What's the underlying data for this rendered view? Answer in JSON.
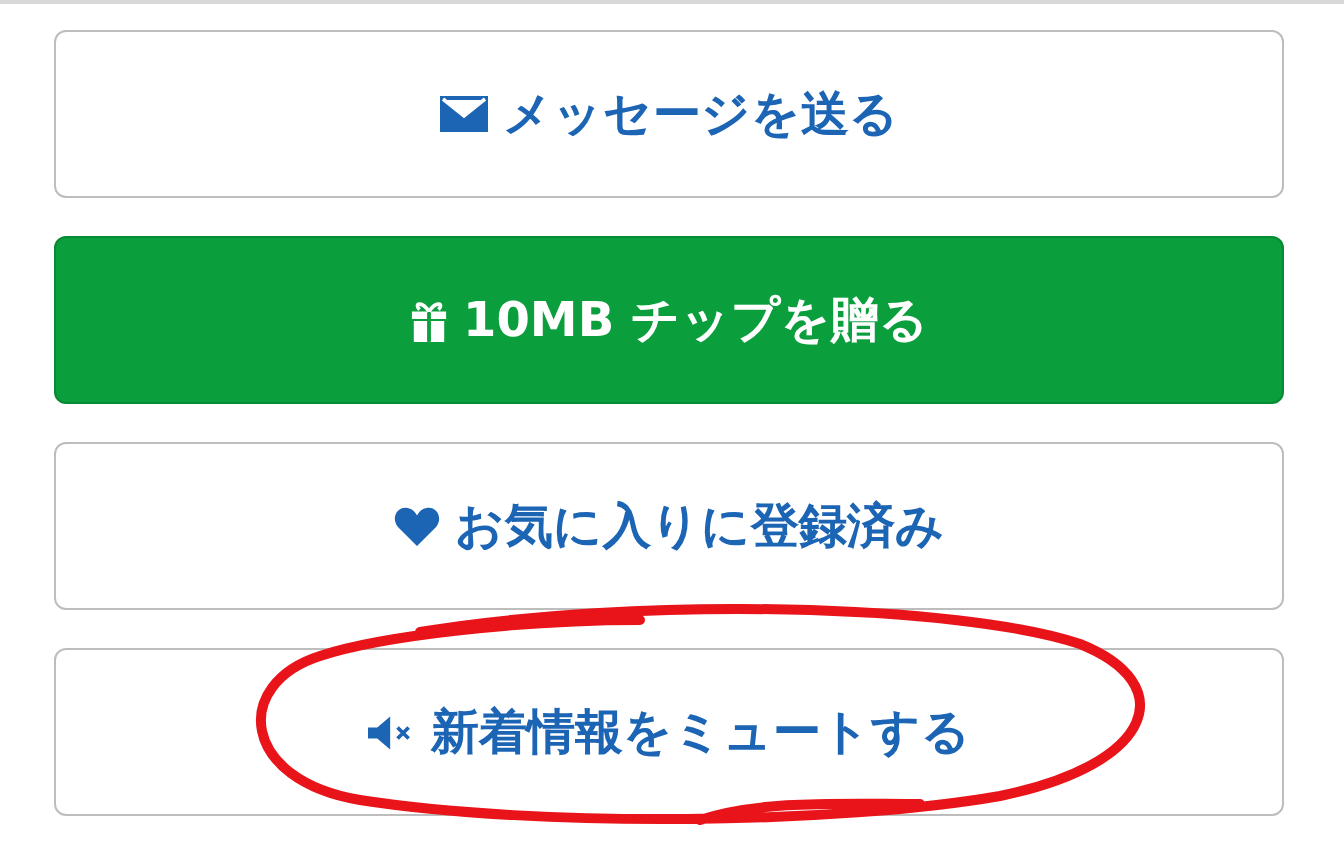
{
  "buttons": [
    {
      "kind": "outline",
      "label": "メッセージを送る"
    },
    {
      "kind": "primary",
      "label": "10MB チップを贈る"
    },
    {
      "kind": "outline",
      "label": "お気に入りに登録済み"
    },
    {
      "kind": "outline",
      "label": "新着情報をミュートする"
    }
  ]
}
